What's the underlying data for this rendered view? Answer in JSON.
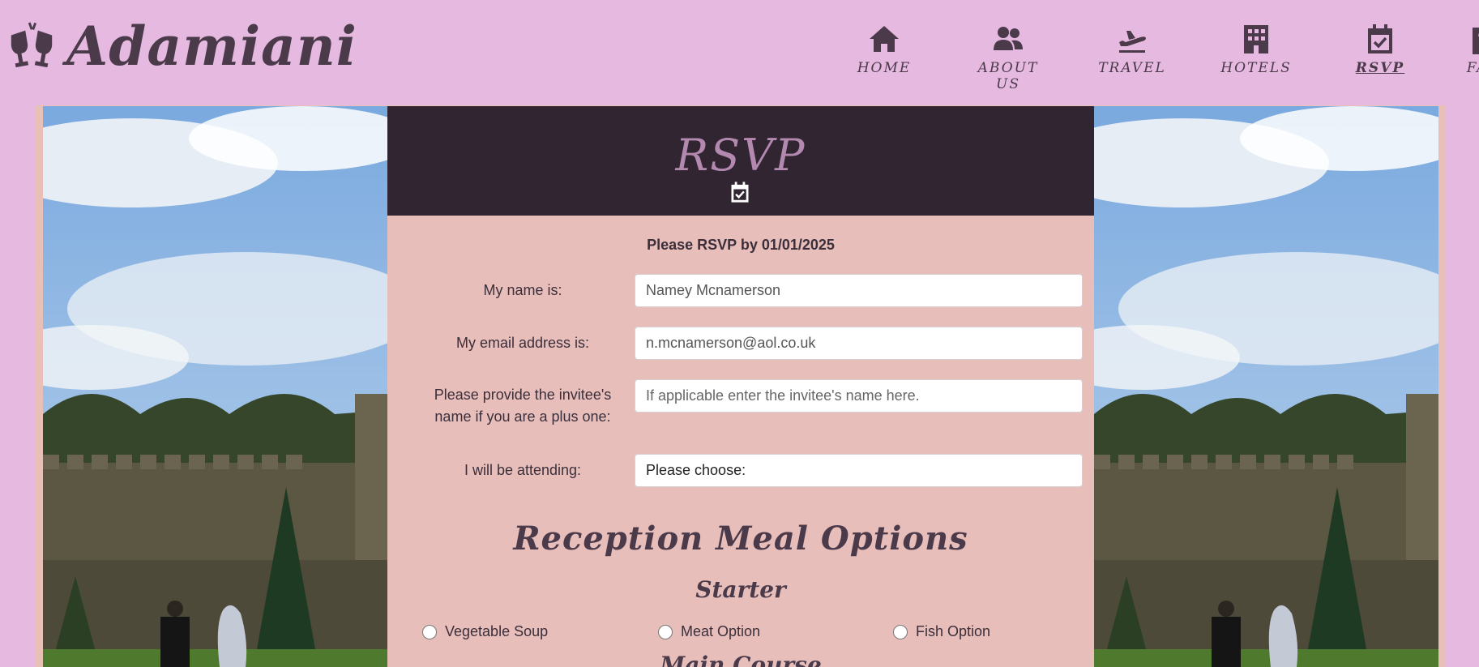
{
  "brand": {
    "name": "Adamiani",
    "icon": "glasses-cheers-icon"
  },
  "nav": {
    "items": [
      {
        "label": "HOME",
        "icon": "home-icon"
      },
      {
        "label": "ABOUT US",
        "icon": "users-icon"
      },
      {
        "label": "TRAVEL",
        "icon": "plane-icon"
      },
      {
        "label": "HOTELS",
        "icon": "hotel-icon"
      },
      {
        "label": "RSVP",
        "icon": "calendar-check-icon",
        "active": true
      },
      {
        "label": "FAQ",
        "icon": "clipboard-question-icon"
      }
    ]
  },
  "rsvp": {
    "title": "RSVP",
    "deadline": "Please RSVP by 01/01/2025",
    "name": {
      "label": "My name is:",
      "value": "Namey Mcnamerson"
    },
    "email": {
      "label": "My email address is:",
      "value": "n.mcnamerson@aol.co.uk"
    },
    "plus_one": {
      "label_line1": "Please provide the invitee's",
      "label_line2": "name if you are a plus one:",
      "placeholder": "If applicable enter the invitee's name here."
    },
    "attending": {
      "label": "I will be attending:",
      "selected": "Please choose:"
    }
  },
  "meals": {
    "title": "Reception Meal Options",
    "starter_title": "Starter",
    "starter_options": [
      "Vegetable Soup",
      "Meat Option",
      "Fish Option"
    ],
    "main_title": "Main Course"
  },
  "colors": {
    "background": "#e6b9e0",
    "panel": "#e8bebb",
    "panel_header": "#302530",
    "accent": "#b489b0"
  }
}
